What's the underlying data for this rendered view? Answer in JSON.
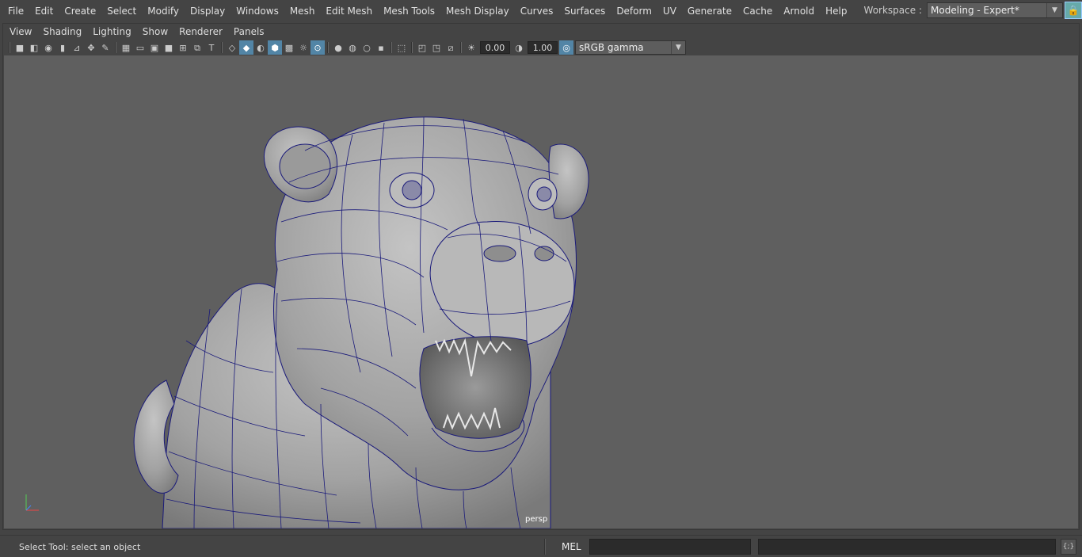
{
  "menubar": {
    "items": [
      "File",
      "Edit",
      "Create",
      "Select",
      "Modify",
      "Display",
      "Windows",
      "Mesh",
      "Edit Mesh",
      "Mesh Tools",
      "Mesh Display",
      "Curves",
      "Surfaces",
      "Deform",
      "UV",
      "Generate",
      "Cache",
      "Arnold",
      "Help"
    ]
  },
  "workspace": {
    "label": "Workspace :",
    "value": "Modeling - Expert*"
  },
  "panel_menu": {
    "items": [
      "View",
      "Shading",
      "Lighting",
      "Show",
      "Renderer",
      "Panels"
    ]
  },
  "toolbar": {
    "exposure": "0.00",
    "gamma": "1.00",
    "color_management": "sRGB gamma"
  },
  "viewport": {
    "camera_label": "persp",
    "axis_y": "y",
    "axis_z": "z",
    "axis_x": "x",
    "background_color": "#5f5f5f",
    "wire_color": "#1a1a7a"
  },
  "statusbar": {
    "help_line": "Select Tool: select an object",
    "command_language": "MEL",
    "command_input": "",
    "script_editor_icon": "{;}"
  }
}
